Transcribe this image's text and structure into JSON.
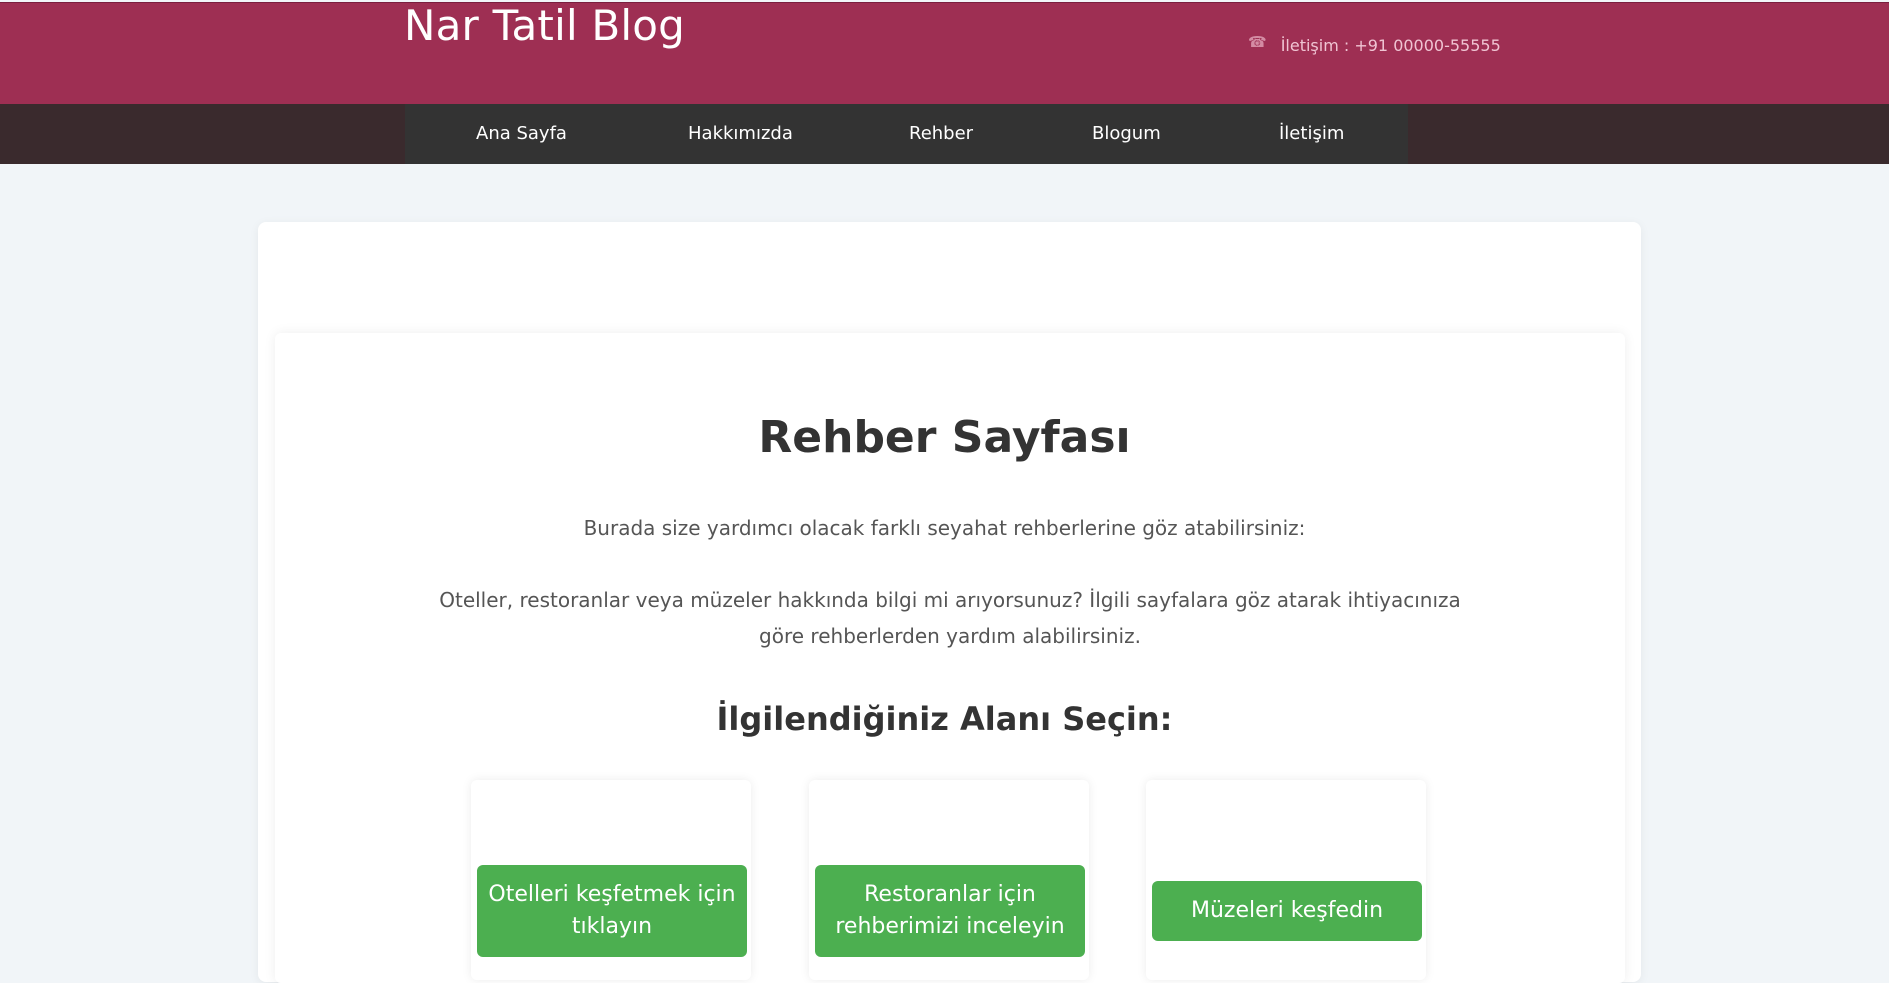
{
  "header": {
    "brand": "Nar Tatil Blog",
    "contact_icon": "phone-icon",
    "contact_text": "İletişim : +91 00000-55555"
  },
  "nav": {
    "items": [
      "Ana Sayfa",
      "Hakkımızda",
      "Rehber",
      "Blogum",
      "İletişim"
    ]
  },
  "main": {
    "title": "Rehber Sayfası",
    "intro": "Burada size yardımcı olacak farklı seyahat rehberlerine göz atabilirsiniz:",
    "detail": "Oteller, restoranlar veya müzeler hakkında bilgi mi arıyorsunuz? İlgili sayfalara göz atarak ihtiyacınıza göre rehberlerden yardım alabilirsiniz.",
    "section_title": "İlgilendiğiniz Alanı Seçin:",
    "choices": [
      {
        "label": "Otelleri keşfetmek için tıklayın"
      },
      {
        "label": "Restoranlar için rehberimizi inceleyin"
      },
      {
        "label": "Müzeleri keşfedin"
      }
    ]
  },
  "colors": {
    "header_bg": "#9e2f53",
    "nav_bg": "#333333",
    "button_bg": "#4caf50",
    "page_bg": "#f1f5f8"
  }
}
